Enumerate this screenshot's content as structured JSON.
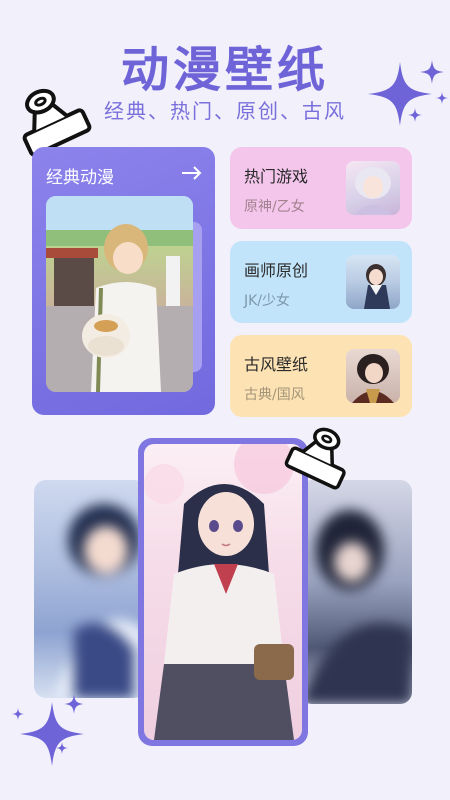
{
  "header": {
    "title": "动漫壁纸",
    "subtitle": "经典、热门、原创、古风"
  },
  "featured": {
    "label": "经典动漫",
    "arrow_icon": "arrow-right-icon"
  },
  "categories": [
    {
      "name": "热门游戏",
      "tags": "原神/乙女",
      "bg": "#f4c6ec",
      "tag_color": "#a2828f"
    },
    {
      "name": "画师原创",
      "tags": "JK/少女",
      "bg": "#c2e4fb",
      "tag_color": "#7d98ab"
    },
    {
      "name": "古风壁纸",
      "tags": "古典/国风",
      "bg": "#fde3b4",
      "tag_color": "#a39578"
    }
  ],
  "colors": {
    "accent": "#6e64d8",
    "background": "#f1f0fb"
  }
}
